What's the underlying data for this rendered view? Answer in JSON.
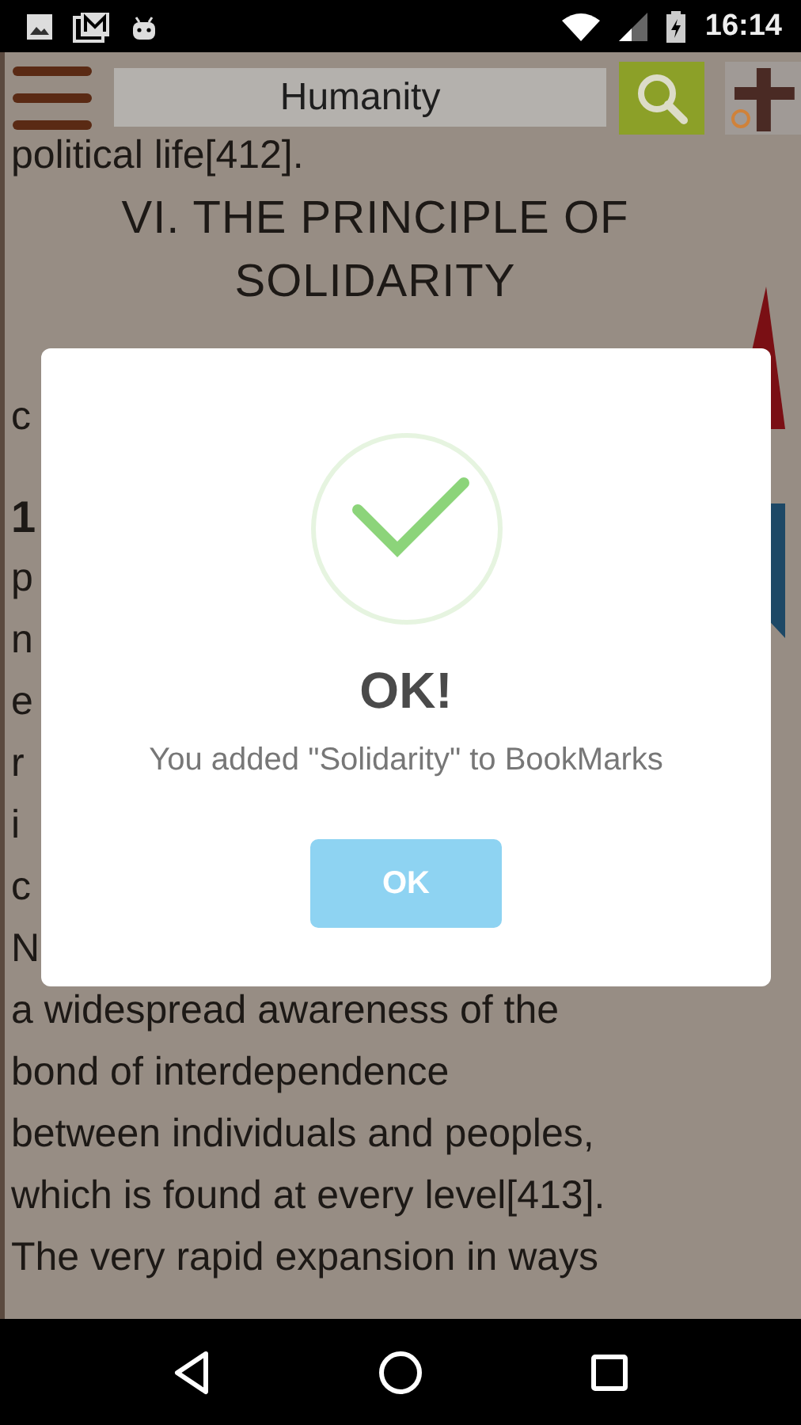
{
  "status_bar": {
    "time": "16:14"
  },
  "toolbar": {
    "search": {
      "value": "Humanity"
    }
  },
  "page": {
    "lines_above": [
      "political life[412]."
    ],
    "heading": [
      "VI. THE PRINCIPLE OF",
      "SOLIDARITY"
    ],
    "hidden_line_starts": [
      {
        "text": "c",
        "kind": "text"
      },
      {
        "text": "1",
        "kind": "number"
      },
      {
        "text": "p",
        "kind": "text"
      },
      {
        "text": "n",
        "kind": "text"
      },
      {
        "text": "e",
        "kind": "text"
      },
      {
        "text": "r",
        "kind": "text"
      },
      {
        "text": "i",
        "kind": "text"
      },
      {
        "text": "c",
        "kind": "text"
      },
      {
        "text": "N",
        "kind": "text"
      }
    ],
    "lines_below": [
      "a widespread awareness of the",
      "bond of interdependence",
      "between individuals and peoples,",
      "which is found at every level[413].",
      "The very rapid expansion in ways"
    ]
  },
  "dialog": {
    "title": "OK!",
    "message": "You added \"Solidarity\" to BookMarks",
    "button": "OK"
  }
}
